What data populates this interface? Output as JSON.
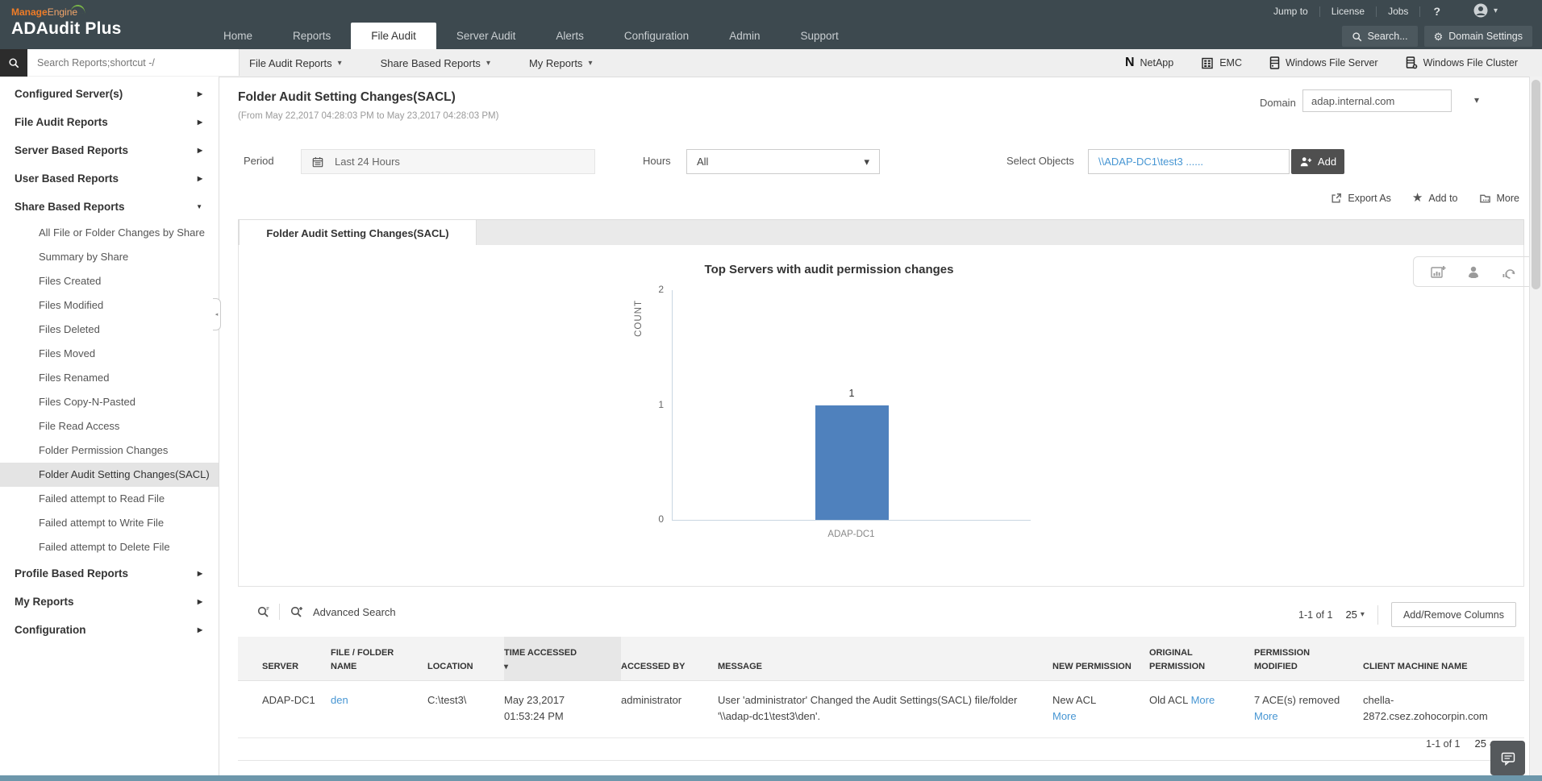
{
  "colors": {
    "header_bg": "#3d494f",
    "brand_orange": "#ef7c27",
    "link_blue": "#4796d3",
    "bar_blue": "#4f81bd",
    "selected_item_bg": "#e4e4e4"
  },
  "brand": {
    "manage": "Manage",
    "engine": "Engine",
    "product": "ADAudit Plus"
  },
  "topbar": {
    "links": [
      "Jump to",
      "License",
      "Jobs"
    ],
    "search_button": "Search...",
    "domain_settings_button": "Domain Settings",
    "tabs": [
      {
        "label": "Home",
        "active": false
      },
      {
        "label": "Reports",
        "active": false
      },
      {
        "label": "File Audit",
        "active": true
      },
      {
        "label": "Server Audit",
        "active": false
      },
      {
        "label": "Alerts",
        "active": false
      },
      {
        "label": "Configuration",
        "active": false
      },
      {
        "label": "Admin",
        "active": false
      },
      {
        "label": "Support",
        "active": false
      }
    ]
  },
  "toolbar": {
    "search_placeholder": "Search Reports;shortcut -/",
    "menus": [
      "File Audit Reports",
      "Share Based Reports",
      "My Reports"
    ],
    "platforms": [
      {
        "label": "NetApp",
        "icon": "netapp-icon"
      },
      {
        "label": "EMC",
        "icon": "emc-icon"
      },
      {
        "label": "Windows File Server",
        "icon": "file-server-icon"
      },
      {
        "label": "Windows File Cluster",
        "icon": "file-cluster-icon"
      }
    ]
  },
  "sidebar": {
    "sections": [
      {
        "label": "Configured Server(s)",
        "expanded": false
      },
      {
        "label": "File Audit Reports",
        "expanded": false
      },
      {
        "label": "Server Based Reports",
        "expanded": false
      },
      {
        "label": "User Based Reports",
        "expanded": false
      },
      {
        "label": "Share Based Reports",
        "expanded": true,
        "items": [
          {
            "label": "All File or Folder Changes by Share",
            "selected": false
          },
          {
            "label": "Summary by Share",
            "selected": false
          },
          {
            "label": "Files Created",
            "selected": false
          },
          {
            "label": "Files Modified",
            "selected": false
          },
          {
            "label": "Files Deleted",
            "selected": false
          },
          {
            "label": "Files Moved",
            "selected": false
          },
          {
            "label": "Files Renamed",
            "selected": false
          },
          {
            "label": "Files Copy-N-Pasted",
            "selected": false
          },
          {
            "label": "File Read Access",
            "selected": false
          },
          {
            "label": "Folder Permission Changes",
            "selected": false
          },
          {
            "label": "Folder Audit Setting Changes(SACL)",
            "selected": true
          },
          {
            "label": "Failed attempt to Read File",
            "selected": false
          },
          {
            "label": "Failed attempt to Write File",
            "selected": false
          },
          {
            "label": "Failed attempt to Delete File",
            "selected": false
          }
        ]
      },
      {
        "label": "Profile Based Reports",
        "expanded": false
      },
      {
        "label": "My Reports",
        "expanded": false
      },
      {
        "label": "Configuration",
        "expanded": false
      }
    ]
  },
  "report": {
    "title": "Folder Audit Setting Changes(SACL)",
    "date_range": "(From May 22,2017 04:28:03 PM to May 23,2017 04:28:03 PM)",
    "domain_label": "Domain",
    "domain_value": "adap.internal.com",
    "period_label": "Period",
    "period_value": "Last 24 Hours",
    "hours_label": "Hours",
    "hours_value": "All",
    "select_objects_label": "Select Objects",
    "select_objects_value": "\\\\ADAP-DC1\\test3 ......",
    "add_button": "Add",
    "export_as": "Export As",
    "add_to": "Add to",
    "more": "More",
    "tab": "Folder Audit Setting Changes(SACL)"
  },
  "chart_data": {
    "type": "bar",
    "title": "Top Servers with audit permission changes",
    "xlabel": "",
    "ylabel": "COUNT",
    "categories": [
      "ADAP-DC1"
    ],
    "values": [
      1
    ],
    "ylim": [
      0,
      2
    ],
    "yticks": [
      0,
      1,
      2
    ],
    "bar_color": "#4f81bd",
    "grid": false,
    "legend": false
  },
  "table": {
    "advanced_search_label": "Advanced Search",
    "pagination": "1-1 of 1",
    "page_size": "25",
    "add_remove_columns_button": "Add/Remove Columns",
    "sorted_column": "TIME ACCESSED",
    "columns": [
      "SERVER",
      "FILE / FOLDER NAME",
      "LOCATION",
      "TIME ACCESSED",
      "ACCESSED BY",
      "MESSAGE",
      "NEW PERMISSION",
      "ORIGINAL PERMISSION",
      "PERMISSION MODIFIED",
      "CLIENT MACHINE NAME"
    ],
    "rows": [
      {
        "server": "ADAP-DC1",
        "file_folder_name": "den",
        "location": "C:\\test3\\",
        "time_accessed": "May 23,2017 01:53:24 PM",
        "accessed_by": "administrator",
        "message": "User 'administrator' Changed the Audit Settings(SACL) file/folder '\\\\adap-dc1\\test3\\den'.",
        "new_permission": "New ACL",
        "new_permission_more": "More",
        "original_permission": "Old ACL",
        "original_permission_more": "More",
        "permission_modified": "7 ACE(s) removed",
        "permission_modified_more": "More",
        "client_machine_name": "chella-2872.csez.zohocorpin.com"
      }
    ],
    "pagination_bottom": "1-1 of 1",
    "page_size_bottom": "25"
  }
}
